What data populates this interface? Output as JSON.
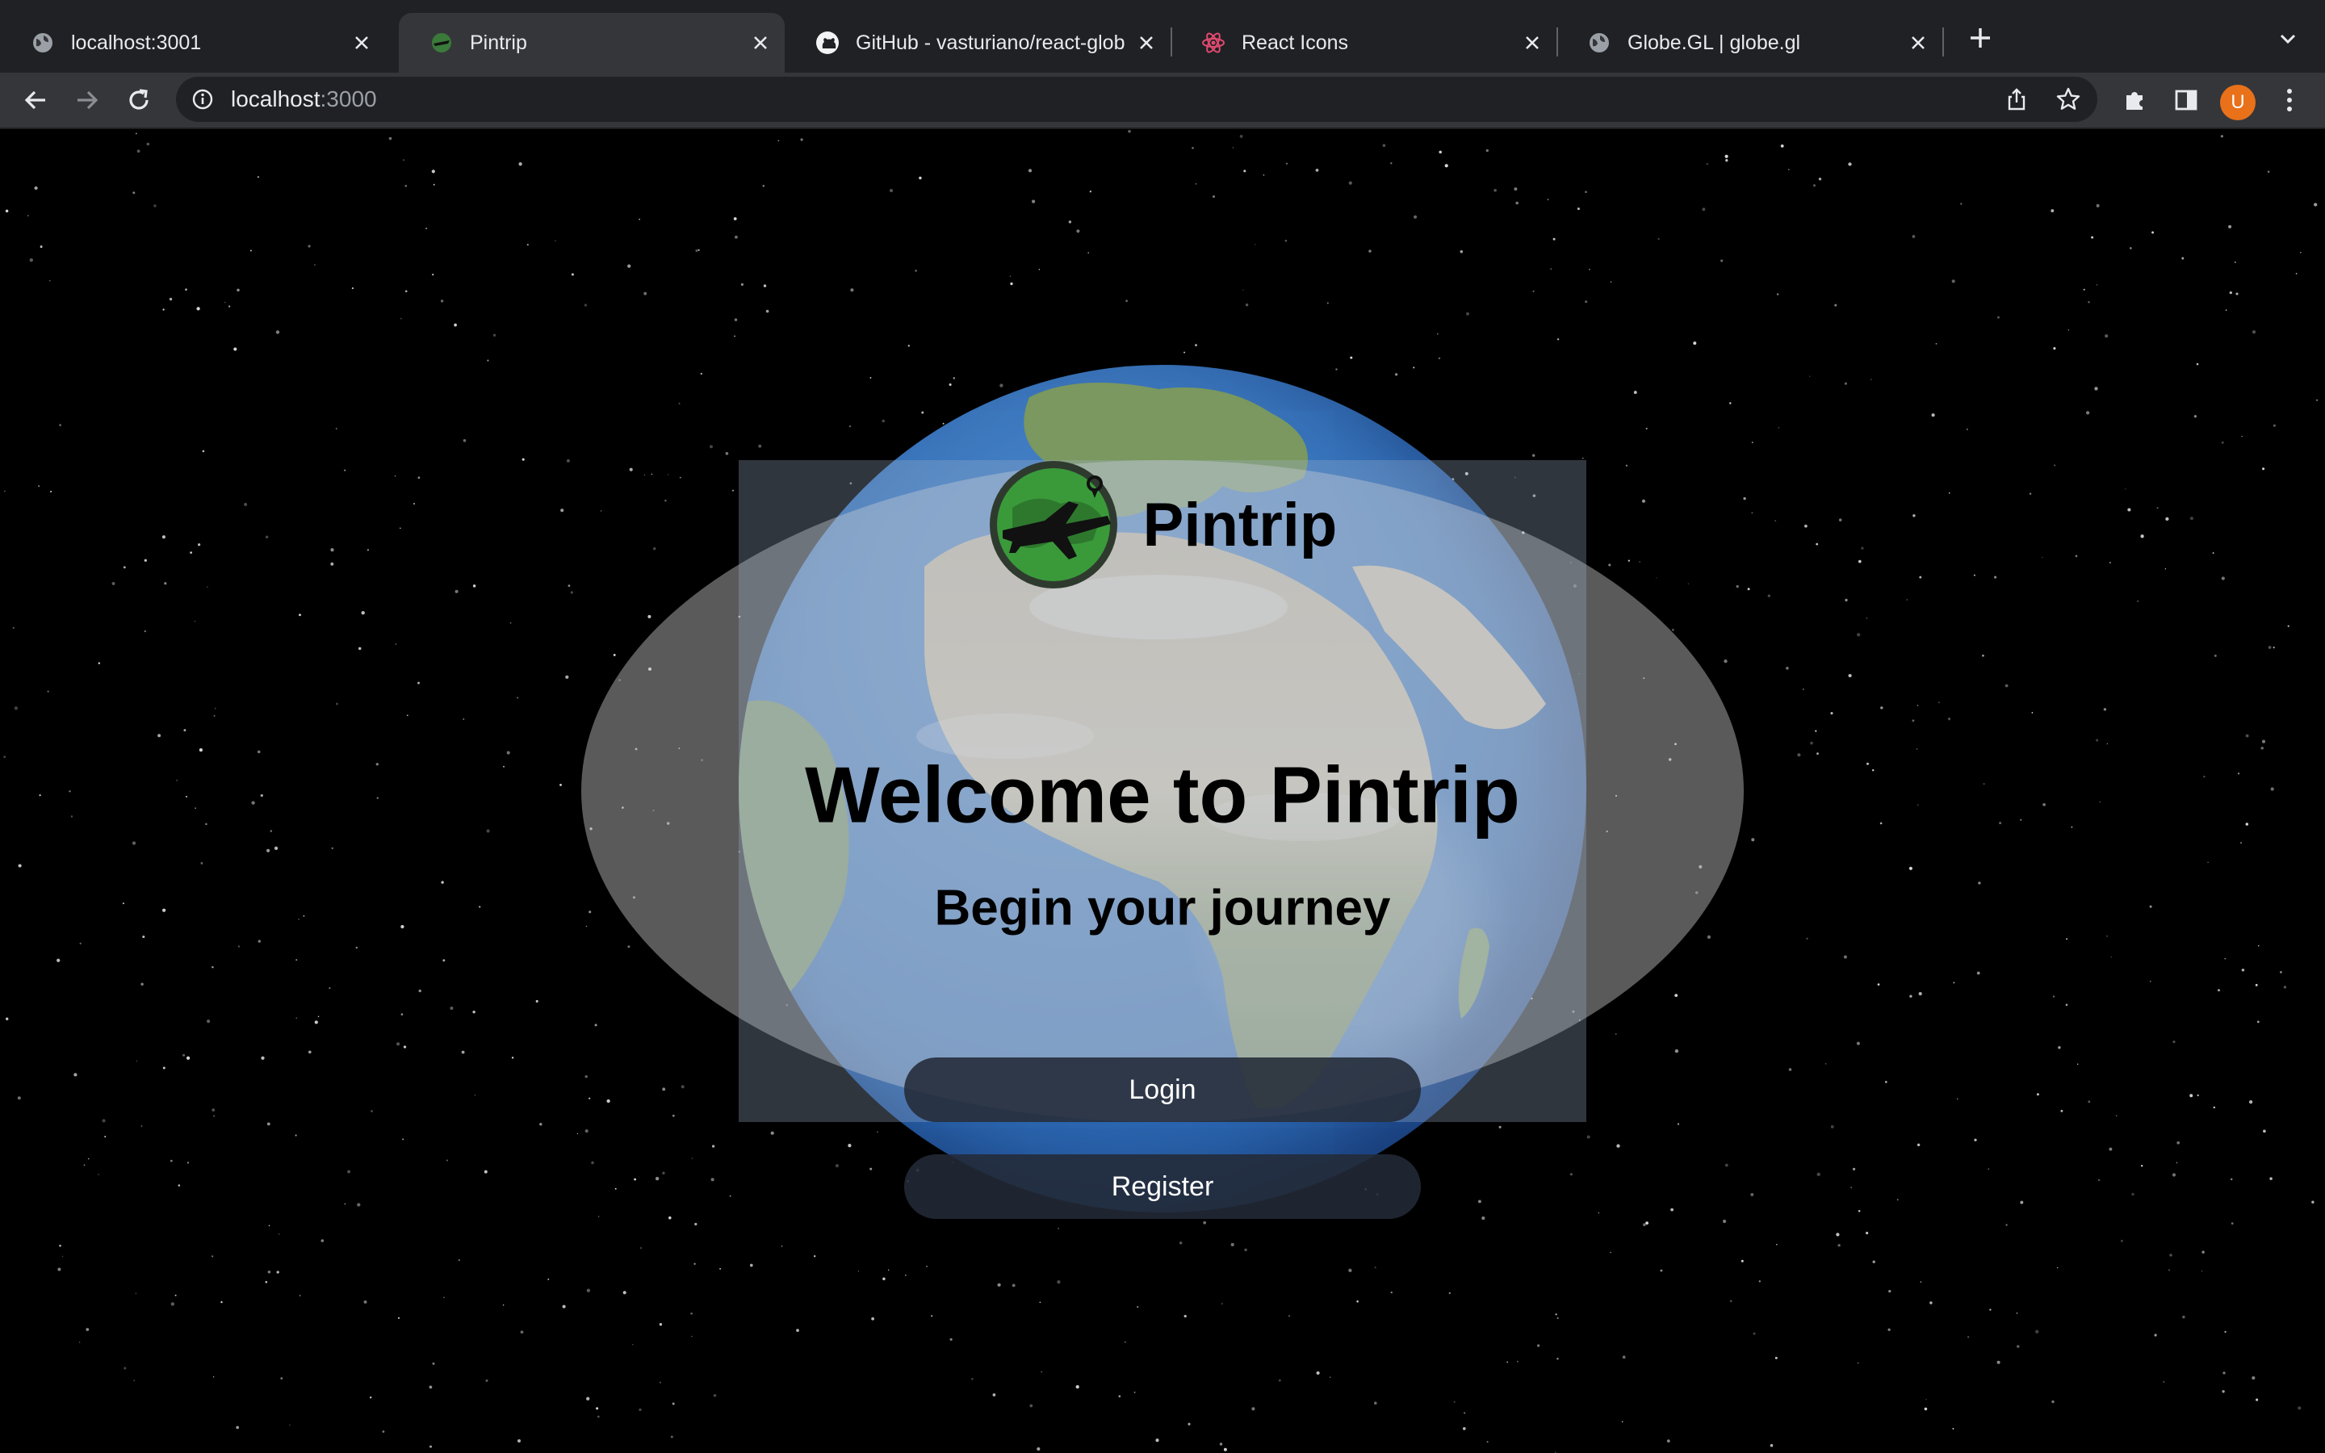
{
  "browser": {
    "tabs": [
      {
        "title": "localhost:3001",
        "icon": "globe-icon",
        "active": false
      },
      {
        "title": "Pintrip",
        "icon": "pintrip-favicon",
        "active": true
      },
      {
        "title": "GitHub - vasturiano/react-glob",
        "icon": "github-icon",
        "active": false
      },
      {
        "title": "React Icons",
        "icon": "react-icon",
        "active": false
      },
      {
        "title": "Globe.GL | globe.gl",
        "icon": "globe-icon",
        "active": false
      }
    ],
    "address": {
      "host": "localhost",
      "port": ":3000"
    },
    "profile_initial": "U"
  },
  "page": {
    "brand_name": "Pintrip",
    "welcome_heading": "Welcome to Pintrip",
    "tagline": "Begin your journey",
    "login_label": "Login",
    "register_label": "Register"
  },
  "colors": {
    "chrome_dark": "#202124",
    "chrome_tab": "#35363a",
    "avatar": "#e8711a",
    "button_bg": "#232a37",
    "logo_green": "#3a9a3a"
  }
}
